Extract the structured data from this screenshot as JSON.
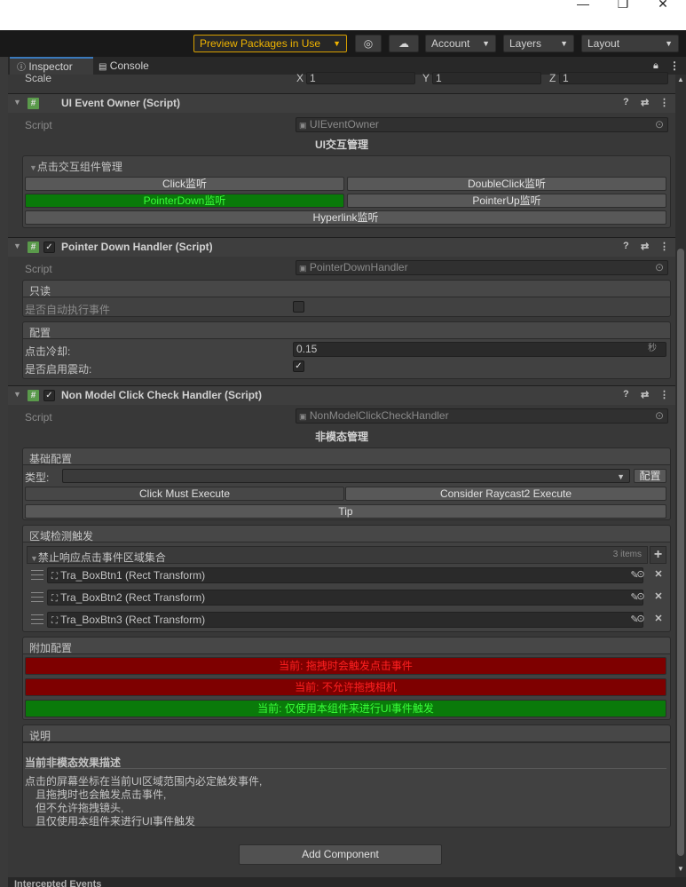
{
  "window": {
    "minimize": "—",
    "maximize": "❐",
    "close": "✕"
  },
  "toolbar": {
    "preview_packages": "Preview Packages in Use",
    "account": "Account",
    "layers": "Layers",
    "layout": "Layout"
  },
  "tabs": {
    "inspector": "Inspector",
    "console": "Console"
  },
  "transform": {
    "scale_label": "Scale",
    "x_label": "X",
    "x_value": "1",
    "y_label": "Y",
    "y_value": "1",
    "z_label": "Z",
    "z_value": "1"
  },
  "ui_event_owner": {
    "title": "UI Event Owner (Script)",
    "script_label": "Script",
    "script_value": "UIEventOwner",
    "section_title": "UI交互管理",
    "foldout": "点击交互组件管理",
    "buttons": [
      "Click监听",
      "DoubleClick监听",
      "PointerDown监听",
      "PointerUp监听",
      "Hyperlink监听"
    ]
  },
  "pointer_down": {
    "title": "Pointer Down Handler (Script)",
    "script_label": "Script",
    "script_value": "PointerDownHandler",
    "readonly_header": "只读",
    "auto_exec_label": "是否自动执行事件",
    "config_header": "配置",
    "cooldown_label": "点击冷却:",
    "cooldown_value": "0.15",
    "cooldown_unit": "秒",
    "vibrate_label": "是否启用震动:"
  },
  "non_model": {
    "title": "Non Model Click Check Handler (Script)",
    "script_label": "Script",
    "script_value": "NonModelClickCheckHandler",
    "section_title": "非模态管理",
    "basic_header": "基础配置",
    "type_label": "类型:",
    "config_btn": "配置",
    "click_must": "Click Must Execute",
    "consider_raycast": "Consider Raycast2 Execute",
    "tip": "Tip",
    "area_header": "区域检测触发",
    "list_title": "禁止响应点击事件区域集合",
    "list_count": "3 items",
    "items": [
      "Tra_BoxBtn1 (Rect Transform)",
      "Tra_BoxBtn2 (Rect Transform)",
      "Tra_BoxBtn3 (Rect Transform)"
    ],
    "extra_header": "附加配置",
    "status1": "当前: 拖拽时会触发点击事件",
    "status2": "当前: 不允许拖拽相机",
    "status3": "当前: 仅使用本组件来进行UI事件触发",
    "desc_header": "说明",
    "desc_title": "当前非模态效果描述",
    "desc_lines": [
      "点击的屏幕坐标在当前UI区域范围内必定触发事件,",
      "且拖拽时也会触发点击事件,",
      "但不允许拖拽镜头,",
      "且仅使用本组件来进行UI事件触发"
    ]
  },
  "add_component": "Add Component",
  "intercepted": "Intercepted Events"
}
